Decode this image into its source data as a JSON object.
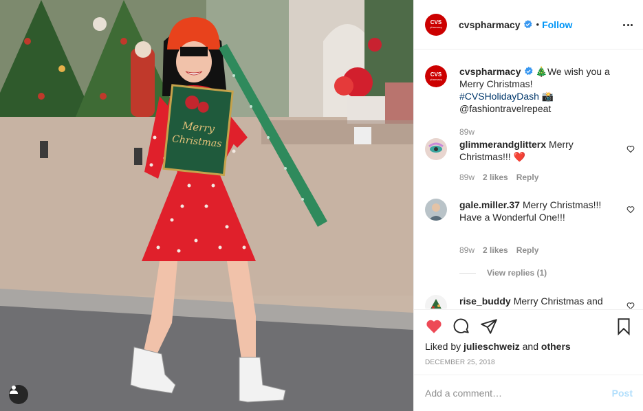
{
  "colors": {
    "accent": "#0095f6",
    "like_red": "#ed4956",
    "brand_red": "#cc0000",
    "hashtag": "#00376b",
    "muted": "#8e8e8e"
  },
  "post_image": {
    "card_line1": "Merry",
    "card_line2": "Christmas"
  },
  "header": {
    "avatar_logo": "CVS",
    "avatar_sub": "pharmacy",
    "username": "cvspharmacy",
    "separator": "•",
    "follow_label": "Follow"
  },
  "caption": {
    "username": "cvspharmacy",
    "text_before": "🎄We wish you a Merry Christmas! ",
    "hashtag": "#CVSHolidayDash",
    "text_after": " 📸@fashiontravelrepeat",
    "time": "89w"
  },
  "comments": [
    {
      "username": "glimmerandglitterx",
      "text": "Merry Christmas!!! ❤️",
      "time": "89w",
      "likes": "2 likes",
      "reply_label": "Reply"
    },
    {
      "username": "gale.miller.37",
      "text": "Merry Christmas!!! Have a Wonderful One!!!",
      "time": "89w",
      "likes": "2 likes",
      "reply_label": "Reply"
    },
    {
      "username": "rise_buddy",
      "text": "Merry Christmas and"
    }
  ],
  "view_replies": "View replies (1)",
  "likes": {
    "prefix": "Liked by ",
    "user": "julieschweiz",
    "middle": " and ",
    "others": "others"
  },
  "date": "DECEMBER 25, 2018",
  "add_comment": {
    "placeholder": "Add a comment…",
    "post_label": "Post"
  },
  "icons": {
    "like": "heart-filled-icon",
    "comment": "comment-bubble-icon",
    "share": "paper-plane-icon",
    "save": "bookmark-icon",
    "more": "more-dots-icon",
    "verified": "verified-badge-icon",
    "user_tags": "person-icon"
  }
}
